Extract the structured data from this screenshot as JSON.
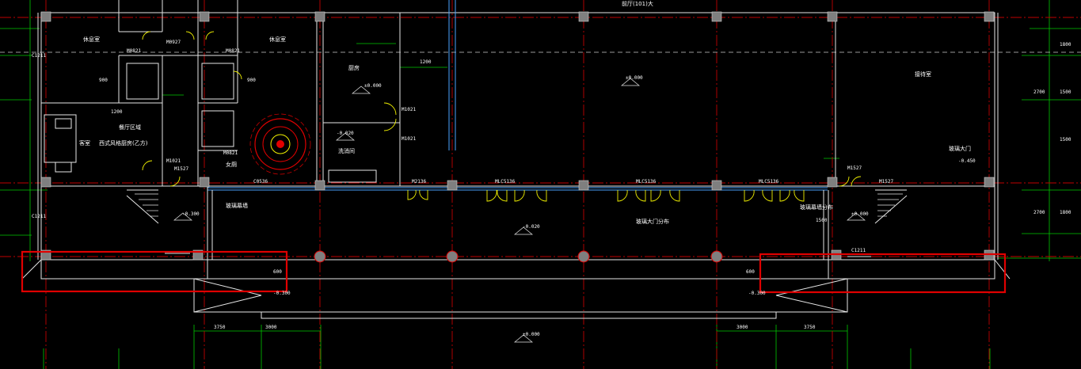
{
  "rooms": {
    "rest_left": "休息室",
    "rest_mid": "休息室",
    "kitchen": "厨房",
    "lobby": "前厅(101)大",
    "reception": "接待室",
    "guest_room": "客室",
    "restroom_mid": "女厕",
    "wash_room": "洗消间",
    "dining_label": "餐厅区域",
    "guest_note": "西式风格厨房(乙方)",
    "door_note": "玻璃大门",
    "corridor_note": "玻璃幕墙",
    "mid_note": "玻璃大门分布",
    "right_note": "玻璃幕墙分布"
  },
  "door_tags": [
    "M0927",
    "M0821",
    "M0821",
    "M0821",
    "M1527",
    "M1527",
    "M1021",
    "M1021",
    "M1021",
    "M2136",
    "MLC5136",
    "MLC5136",
    "MLC5136",
    "M1527"
  ],
  "window_tags": [
    "C1211",
    "C1211",
    "C1211",
    "C0536"
  ],
  "elevations": [
    "-0.300",
    "±0.000",
    "±0.000",
    "-0.020",
    "-0.020",
    "±0.000",
    "±0.000",
    "-0.300",
    "-0.300",
    "-0.450"
  ],
  "dimensions": [
    "3750",
    "3000",
    "3000",
    "3750",
    "1800",
    "1500",
    "1500",
    "1800",
    "2700",
    "2700",
    "900",
    "900",
    "1200",
    "1200",
    "600",
    "600",
    "1500"
  ],
  "colors": {
    "background": "#000000",
    "wall": "#e6e6e6",
    "axis": "#c00000",
    "dimension": "#00c800",
    "door": "#f0f000",
    "highlight": "#e00000",
    "column": "#7f7f7f",
    "window": "#4aa3ff"
  },
  "highlights": [
    "left-canopy",
    "right-canopy"
  ]
}
